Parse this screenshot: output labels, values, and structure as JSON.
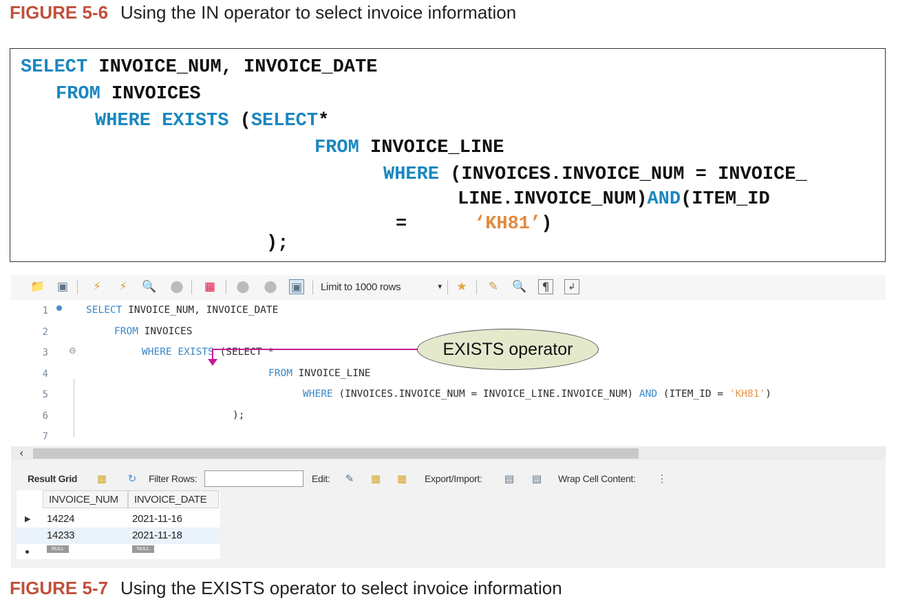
{
  "captions": {
    "top": {
      "label": "FIGURE 5-6",
      "text": "Using the IN operator to select invoice information"
    },
    "bottom": {
      "label": "FIGURE 5-7",
      "text": "Using the EXISTS operator to select invoice information"
    }
  },
  "printed_code": {
    "l1_kw": "SELECT",
    "l1_rest": " INVOICE_NUM, INVOICE_DATE",
    "l2_kw": "FROM",
    "l2_rest": " INVOICES",
    "l3_kw": "WHERE EXISTS",
    "l3_paren": " (",
    "l3_kw2": "SELECT",
    "l3_star": "*",
    "l4_kw": "FROM",
    "l4_rest": " INVOICE_LINE",
    "l5_kw": "WHERE",
    "l5_rest": " (INVOICES.INVOICE_NUM = INVOICE_",
    "l6_pre": "LINE.INVOICE_NUM)",
    "l6_kw": "AND",
    "l6_rest": "(ITEM_ID",
    "l7_eq": "=",
    "l7_str": "‘KH81’",
    "l7_close": ")",
    "l8": ");"
  },
  "toolbar": {
    "limit_label": "Limit to 1000 rows",
    "icons": [
      "folder-icon",
      "save-icon",
      "execute-icon",
      "execute-current-icon",
      "explain-icon",
      "stop-icon",
      "toggle-error-icon",
      "commit-icon",
      "rollback-icon",
      "autocommit-icon",
      "bookmark-icon",
      "beautify-icon",
      "find-icon",
      "invisible-chars-icon",
      "wrap-icon"
    ]
  },
  "editor": {
    "line_numbers": [
      "1",
      "2",
      "3",
      "4",
      "5",
      "6",
      "7"
    ],
    "l1_kw": "SELECT",
    "l1_rest": " INVOICE_NUM, INVOICE_DATE",
    "l2_kw": "FROM",
    "l2_rest": " INVOICES",
    "l3_kw": "WHERE EXISTS",
    "l3_rest": " (SELECT *",
    "l4_kw": "FROM",
    "l4_rest": " INVOICE_LINE",
    "l5_kw": "WHERE",
    "l5_mid": " (INVOICES.INVOICE_NUM = INVOICE_LINE.INVOICE_NUM) ",
    "l5_kw2": "AND",
    "l5_pre": " (ITEM_ID = ",
    "l5_str": "'KH81'",
    "l5_close": ")",
    "l6": ");"
  },
  "callout": {
    "text": "EXISTS operator"
  },
  "result_bar": {
    "result_grid": "Result Grid",
    "filter_rows": "Filter Rows:",
    "edit": "Edit:",
    "export_import": "Export/Import:",
    "wrap_cell": "Wrap Cell Content:"
  },
  "grid": {
    "columns": [
      "INVOICE_NUM",
      "INVOICE_DATE"
    ],
    "rows": [
      [
        "14224",
        "2021-11-16"
      ],
      [
        "14233",
        "2021-11-18"
      ]
    ],
    "null_label": "NULL"
  },
  "colors": {
    "sql_keyword": "#1b87c0",
    "sql_string": "#e38a3f",
    "figure_label": "#c0503a",
    "callout_line": "#c8189a",
    "callout_fill": "#e4e9cc"
  }
}
